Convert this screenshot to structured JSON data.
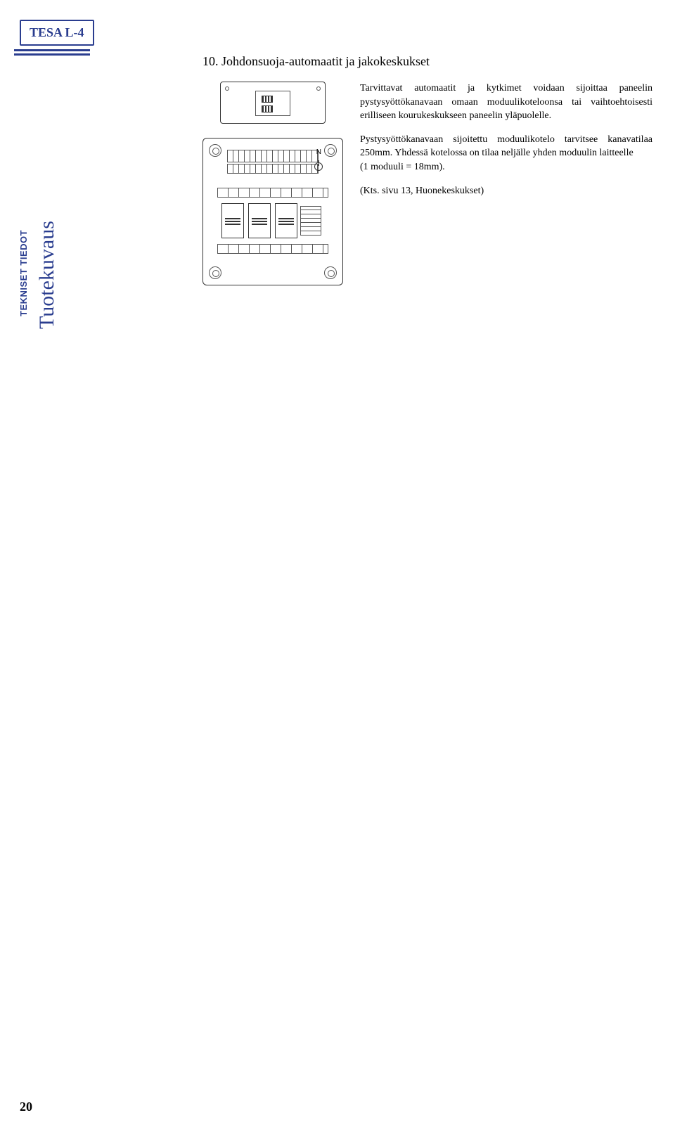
{
  "header": {
    "title": "TESA L-4"
  },
  "sidebar": {
    "small_label": "TEKNISET   TIEDOT",
    "large_label": "Tuotekuvaus"
  },
  "section": {
    "title": "10. Johdonsuoja-automaatit ja jakokeskukset"
  },
  "body": {
    "p1": "Tarvittavat automaatit ja kytkimet voidaan sijoittaa paneelin pystysyöttökanavaan omaan moduulikoteloonsa tai vaihtoehtoisesti erilliseen kourukeskukseen paneelin yläpuolelle.",
    "p2_a": "Pystysyöttökanavaan sijoitettu moduulikotelo tarvitsee kanavatilaa 250mm. Yhdessä kotelossa on tilaa neljälle yhden moduulin laitteelle",
    "p2_b": "(1 moduuli = 18mm).",
    "p3": "(Kts. sivu 13, Huonekeskukset)"
  },
  "diagram": {
    "n_label": "N"
  },
  "footer": {
    "page_number": "20"
  }
}
